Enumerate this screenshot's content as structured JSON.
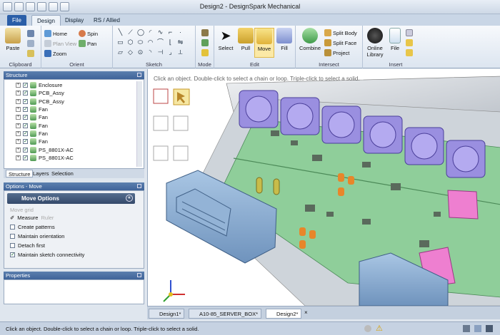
{
  "window": {
    "title": "Design2 - DesignSpark Mechanical"
  },
  "menu": {
    "tabs": [
      {
        "label": "File"
      },
      {
        "label": "Design"
      },
      {
        "label": "Display"
      },
      {
        "label": "RS / Allied"
      }
    ]
  },
  "ribbon": {
    "groups": {
      "clipboard": {
        "label": "Clipboard",
        "paste": "Paste"
      },
      "orient": {
        "label": "Orient",
        "home": "Home",
        "plan_view": "Plan View",
        "zoom": "Zoom",
        "spin": "Spin",
        "pan": "Pan"
      },
      "sketch": {
        "label": "Sketch"
      },
      "mode": {
        "label": "Mode"
      },
      "edit": {
        "label": "Edit",
        "select": "Select",
        "pull": "Pull",
        "move": "Move",
        "fill": "Fill"
      },
      "intersect": {
        "label": "Intersect",
        "combine": "Combine",
        "split_body": "Split Body",
        "split_face": "Split Face",
        "project": "Project"
      },
      "insert": {
        "label": "Insert",
        "online_library": "Online Library",
        "file": "File"
      }
    }
  },
  "structure": {
    "header": "Structure",
    "tree": [
      {
        "label": "Enclosure"
      },
      {
        "label": "PCB_Assy"
      },
      {
        "label": "PCB_Assy"
      },
      {
        "label": "Fan"
      },
      {
        "label": "Fan"
      },
      {
        "label": "Fan"
      },
      {
        "label": "Fan"
      },
      {
        "label": "Fan"
      },
      {
        "label": "PS_8801X-AC"
      },
      {
        "label": "PS_8801X-AC"
      }
    ],
    "tabs": [
      {
        "label": "Structure"
      },
      {
        "label": "Layers"
      },
      {
        "label": "Selection"
      }
    ]
  },
  "options": {
    "header": "Options - Move",
    "panel_title": "Move Options",
    "move_grid": "Move grid",
    "measure": "Measure",
    "ruler": "Ruler",
    "items": [
      {
        "label": "Create patterns",
        "checked": false
      },
      {
        "label": "Maintain orientation",
        "checked": false
      },
      {
        "label": "Detach first",
        "checked": false
      },
      {
        "label": "Maintain sketch connectivity",
        "checked": true
      }
    ]
  },
  "properties": {
    "header": "Properties"
  },
  "viewport": {
    "hint": "Click an object.  Double-click to select a chain or loop.  Triple-click to select a solid."
  },
  "doc_tabs": [
    {
      "label": "Design1*"
    },
    {
      "label": "A10-85_SERVER_BOX*"
    },
    {
      "label": "Design2*"
    }
  ],
  "status": {
    "text": "Click an object.  Double-click to select a chain or loop.  Triple-click to select a solid."
  },
  "colors": {
    "accent": "#2a5ea8",
    "board": "#8fce9a",
    "fan": "#9a8fe0",
    "orange": "#e8862a",
    "pink": "#ee7fd0"
  }
}
